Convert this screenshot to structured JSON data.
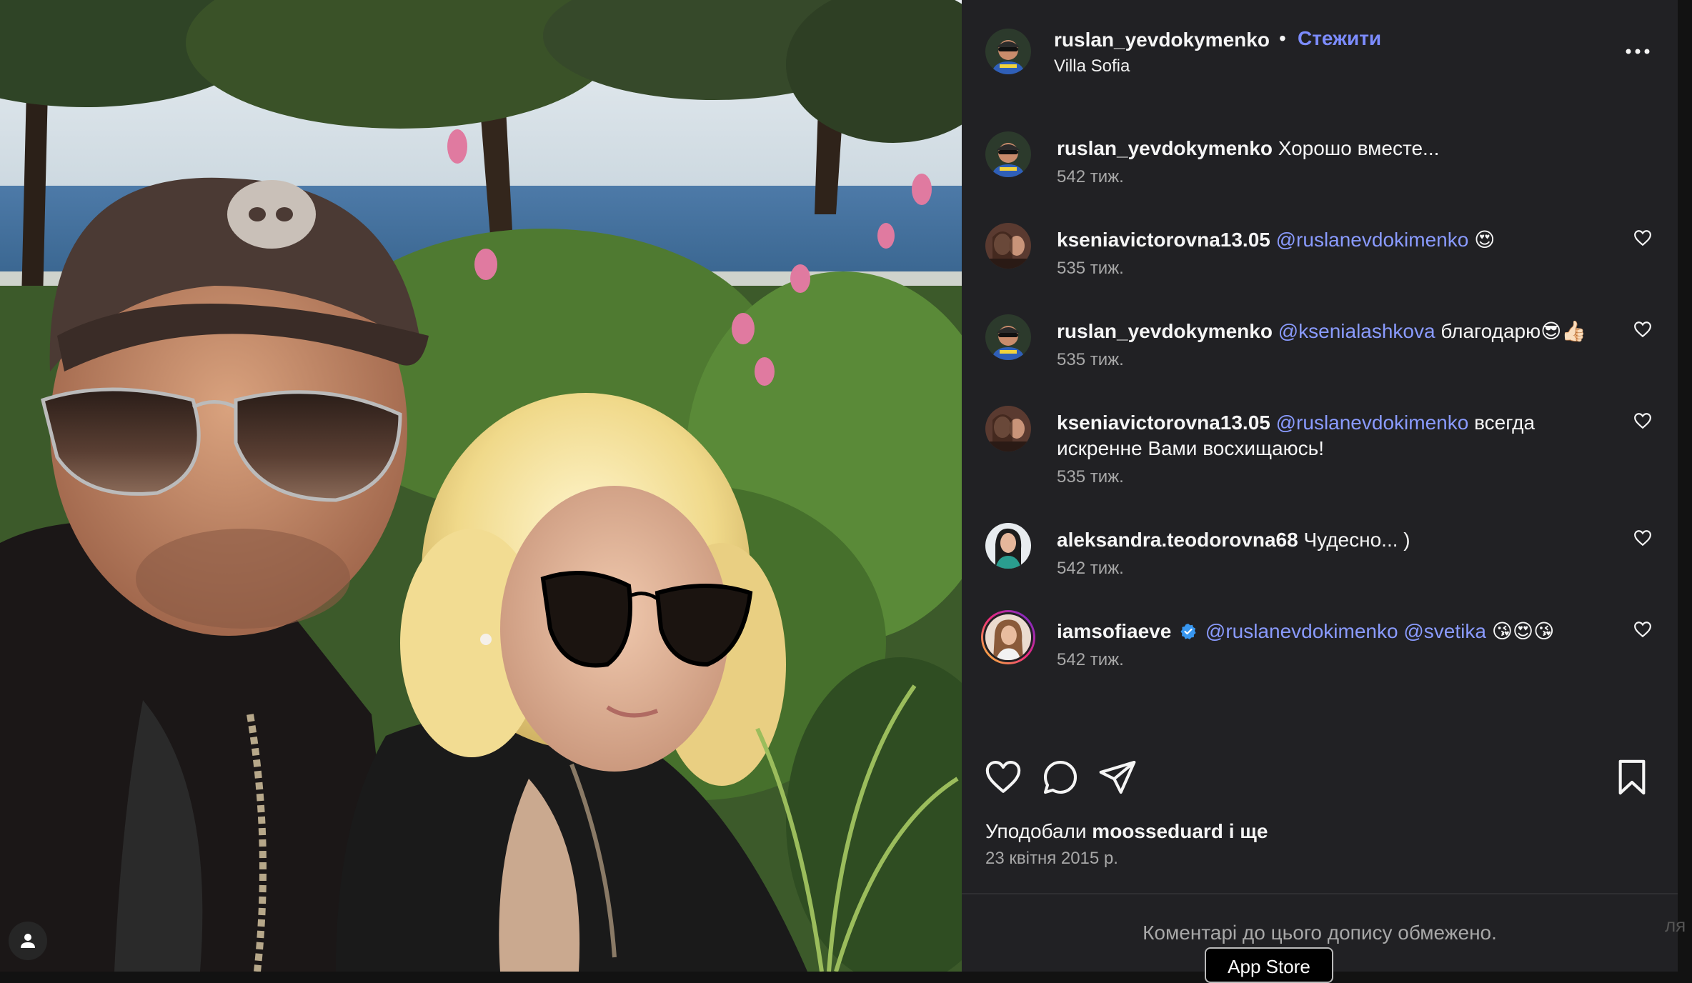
{
  "post": {
    "author": "ruslan_yevdokymenko",
    "separator": "•",
    "follow_label": "Стежити",
    "location": "Villa Sofia"
  },
  "comments": [
    {
      "username": "ruslan_yevdokymenko",
      "mentions": [],
      "text": "Хорошо вместе...",
      "emoji": "",
      "time": "542 тиж.",
      "has_like": false,
      "verified": false
    },
    {
      "username": "kseniavictorovna13.05",
      "mentions": [
        "@ruslanevdokimenko"
      ],
      "text": "",
      "emoji": "😍",
      "time": "535 тиж.",
      "has_like": true,
      "verified": false
    },
    {
      "username": "ruslan_yevdokymenko",
      "mentions": [
        "@ksenialashkova"
      ],
      "text": "благодарю",
      "emoji": "😎👍🏻",
      "time": "535 тиж.",
      "has_like": true,
      "verified": false
    },
    {
      "username": "kseniavictorovna13.05",
      "mentions": [
        "@ruslanevdokimenko"
      ],
      "text": "всегда искренне Вами восхищаюсь!",
      "emoji": "",
      "time": "535 тиж.",
      "has_like": true,
      "verified": false
    },
    {
      "username": "aleksandra.teodorovna68",
      "mentions": [],
      "text": "Чудесно... )",
      "emoji": "",
      "time": "542 тиж.",
      "has_like": true,
      "verified": false
    },
    {
      "username": "iamsofiaeve",
      "mentions": [
        "@ruslanevdokimenko",
        "@svetika"
      ],
      "text": "",
      "emoji": "😘😍😘",
      "time": "542 тиж.",
      "has_like": true,
      "verified": true
    }
  ],
  "likes": {
    "prefix": "Уподобали",
    "user": "moosseduard",
    "suffix": "і ще"
  },
  "date": "23 квітня 2015 р.",
  "comments_restricted": "Коментарі до цього допису обмежено.",
  "app_store_label": "App Store",
  "edge_text": "ля",
  "colors": {
    "accent": "#7c8cff",
    "mention": "#8a9bff",
    "panel_bg": "#212124",
    "muted": "#a8a8a8"
  },
  "icons": [
    "more-icon",
    "heart-icon",
    "comment-icon",
    "share-icon",
    "bookmark-icon",
    "verified-icon",
    "profile-icon"
  ]
}
